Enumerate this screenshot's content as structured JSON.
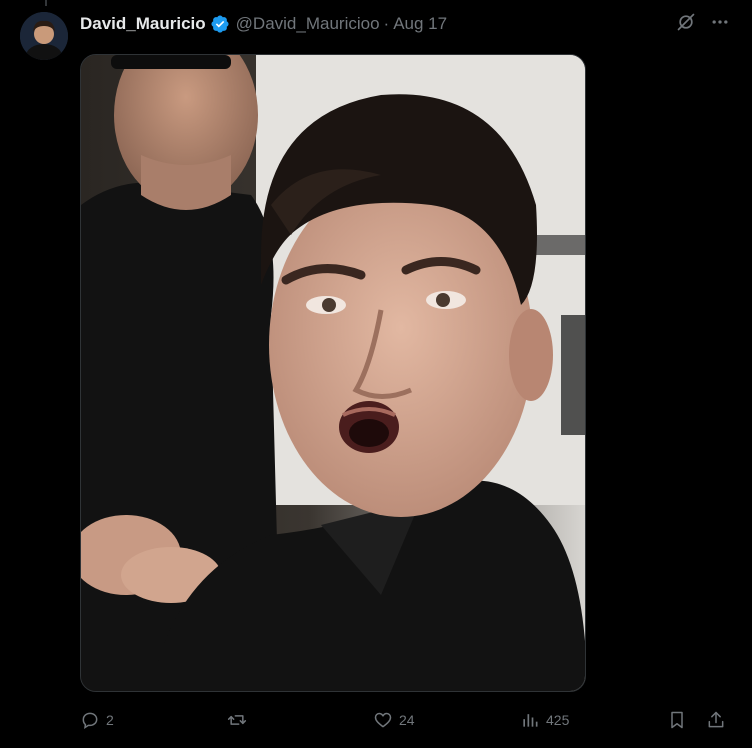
{
  "tweet": {
    "display_name": "David_Mauricio",
    "handle": "@David_Mauricioo",
    "separator": "·",
    "date": "Aug 17",
    "verified": true
  },
  "media": {
    "kind": "photo",
    "subject": "man-with-open-mouth-surprised-expression"
  },
  "actions": {
    "replies": "2",
    "retweets": "",
    "likes": "24",
    "views": "425"
  },
  "colors": {
    "background": "#000000",
    "text_primary": "#e7e9ea",
    "text_secondary": "#71767b",
    "verified_blue": "#1d9bf0",
    "border": "#2f3336"
  },
  "icons": {
    "top_right": [
      "grok-icon",
      "more-icon"
    ],
    "bottom": [
      "reply-icon",
      "retweet-icon",
      "like-icon",
      "views-icon",
      "bookmark-icon",
      "share-icon"
    ]
  }
}
